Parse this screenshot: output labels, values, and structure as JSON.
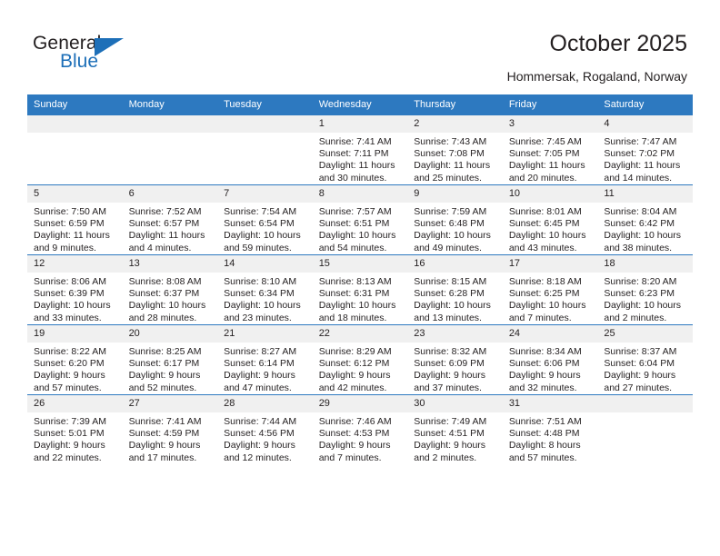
{
  "brand": {
    "name_top": "General",
    "name_bottom": "Blue",
    "accent_color": "#1d6fb8"
  },
  "header": {
    "title": "October 2025",
    "subtitle": "Hommersak, Rogaland, Norway"
  },
  "calendar": {
    "header_bg": "#2d79c0",
    "daynum_bg": "#f0f0f0",
    "weekday_headers": [
      "Sunday",
      "Monday",
      "Tuesday",
      "Wednesday",
      "Thursday",
      "Friday",
      "Saturday"
    ],
    "weeks": [
      [
        {
          "day": "",
          "sunrise": "",
          "sunset": "",
          "daylight_line1": "",
          "daylight_line2": "",
          "empty": true
        },
        {
          "day": "",
          "sunrise": "",
          "sunset": "",
          "daylight_line1": "",
          "daylight_line2": "",
          "empty": true
        },
        {
          "day": "",
          "sunrise": "",
          "sunset": "",
          "daylight_line1": "",
          "daylight_line2": "",
          "empty": true
        },
        {
          "day": "1",
          "sunrise": "Sunrise: 7:41 AM",
          "sunset": "Sunset: 7:11 PM",
          "daylight_line1": "Daylight: 11 hours",
          "daylight_line2": "and 30 minutes."
        },
        {
          "day": "2",
          "sunrise": "Sunrise: 7:43 AM",
          "sunset": "Sunset: 7:08 PM",
          "daylight_line1": "Daylight: 11 hours",
          "daylight_line2": "and 25 minutes."
        },
        {
          "day": "3",
          "sunrise": "Sunrise: 7:45 AM",
          "sunset": "Sunset: 7:05 PM",
          "daylight_line1": "Daylight: 11 hours",
          "daylight_line2": "and 20 minutes."
        },
        {
          "day": "4",
          "sunrise": "Sunrise: 7:47 AM",
          "sunset": "Sunset: 7:02 PM",
          "daylight_line1": "Daylight: 11 hours",
          "daylight_line2": "and 14 minutes."
        }
      ],
      [
        {
          "day": "5",
          "sunrise": "Sunrise: 7:50 AM",
          "sunset": "Sunset: 6:59 PM",
          "daylight_line1": "Daylight: 11 hours",
          "daylight_line2": "and 9 minutes."
        },
        {
          "day": "6",
          "sunrise": "Sunrise: 7:52 AM",
          "sunset": "Sunset: 6:57 PM",
          "daylight_line1": "Daylight: 11 hours",
          "daylight_line2": "and 4 minutes."
        },
        {
          "day": "7",
          "sunrise": "Sunrise: 7:54 AM",
          "sunset": "Sunset: 6:54 PM",
          "daylight_line1": "Daylight: 10 hours",
          "daylight_line2": "and 59 minutes."
        },
        {
          "day": "8",
          "sunrise": "Sunrise: 7:57 AM",
          "sunset": "Sunset: 6:51 PM",
          "daylight_line1": "Daylight: 10 hours",
          "daylight_line2": "and 54 minutes."
        },
        {
          "day": "9",
          "sunrise": "Sunrise: 7:59 AM",
          "sunset": "Sunset: 6:48 PM",
          "daylight_line1": "Daylight: 10 hours",
          "daylight_line2": "and 49 minutes."
        },
        {
          "day": "10",
          "sunrise": "Sunrise: 8:01 AM",
          "sunset": "Sunset: 6:45 PM",
          "daylight_line1": "Daylight: 10 hours",
          "daylight_line2": "and 43 minutes."
        },
        {
          "day": "11",
          "sunrise": "Sunrise: 8:04 AM",
          "sunset": "Sunset: 6:42 PM",
          "daylight_line1": "Daylight: 10 hours",
          "daylight_line2": "and 38 minutes."
        }
      ],
      [
        {
          "day": "12",
          "sunrise": "Sunrise: 8:06 AM",
          "sunset": "Sunset: 6:39 PM",
          "daylight_line1": "Daylight: 10 hours",
          "daylight_line2": "and 33 minutes."
        },
        {
          "day": "13",
          "sunrise": "Sunrise: 8:08 AM",
          "sunset": "Sunset: 6:37 PM",
          "daylight_line1": "Daylight: 10 hours",
          "daylight_line2": "and 28 minutes."
        },
        {
          "day": "14",
          "sunrise": "Sunrise: 8:10 AM",
          "sunset": "Sunset: 6:34 PM",
          "daylight_line1": "Daylight: 10 hours",
          "daylight_line2": "and 23 minutes."
        },
        {
          "day": "15",
          "sunrise": "Sunrise: 8:13 AM",
          "sunset": "Sunset: 6:31 PM",
          "daylight_line1": "Daylight: 10 hours",
          "daylight_line2": "and 18 minutes."
        },
        {
          "day": "16",
          "sunrise": "Sunrise: 8:15 AM",
          "sunset": "Sunset: 6:28 PM",
          "daylight_line1": "Daylight: 10 hours",
          "daylight_line2": "and 13 minutes."
        },
        {
          "day": "17",
          "sunrise": "Sunrise: 8:18 AM",
          "sunset": "Sunset: 6:25 PM",
          "daylight_line1": "Daylight: 10 hours",
          "daylight_line2": "and 7 minutes."
        },
        {
          "day": "18",
          "sunrise": "Sunrise: 8:20 AM",
          "sunset": "Sunset: 6:23 PM",
          "daylight_line1": "Daylight: 10 hours",
          "daylight_line2": "and 2 minutes."
        }
      ],
      [
        {
          "day": "19",
          "sunrise": "Sunrise: 8:22 AM",
          "sunset": "Sunset: 6:20 PM",
          "daylight_line1": "Daylight: 9 hours",
          "daylight_line2": "and 57 minutes."
        },
        {
          "day": "20",
          "sunrise": "Sunrise: 8:25 AM",
          "sunset": "Sunset: 6:17 PM",
          "daylight_line1": "Daylight: 9 hours",
          "daylight_line2": "and 52 minutes."
        },
        {
          "day": "21",
          "sunrise": "Sunrise: 8:27 AM",
          "sunset": "Sunset: 6:14 PM",
          "daylight_line1": "Daylight: 9 hours",
          "daylight_line2": "and 47 minutes."
        },
        {
          "day": "22",
          "sunrise": "Sunrise: 8:29 AM",
          "sunset": "Sunset: 6:12 PM",
          "daylight_line1": "Daylight: 9 hours",
          "daylight_line2": "and 42 minutes."
        },
        {
          "day": "23",
          "sunrise": "Sunrise: 8:32 AM",
          "sunset": "Sunset: 6:09 PM",
          "daylight_line1": "Daylight: 9 hours",
          "daylight_line2": "and 37 minutes."
        },
        {
          "day": "24",
          "sunrise": "Sunrise: 8:34 AM",
          "sunset": "Sunset: 6:06 PM",
          "daylight_line1": "Daylight: 9 hours",
          "daylight_line2": "and 32 minutes."
        },
        {
          "day": "25",
          "sunrise": "Sunrise: 8:37 AM",
          "sunset": "Sunset: 6:04 PM",
          "daylight_line1": "Daylight: 9 hours",
          "daylight_line2": "and 27 minutes."
        }
      ],
      [
        {
          "day": "26",
          "sunrise": "Sunrise: 7:39 AM",
          "sunset": "Sunset: 5:01 PM",
          "daylight_line1": "Daylight: 9 hours",
          "daylight_line2": "and 22 minutes."
        },
        {
          "day": "27",
          "sunrise": "Sunrise: 7:41 AM",
          "sunset": "Sunset: 4:59 PM",
          "daylight_line1": "Daylight: 9 hours",
          "daylight_line2": "and 17 minutes."
        },
        {
          "day": "28",
          "sunrise": "Sunrise: 7:44 AM",
          "sunset": "Sunset: 4:56 PM",
          "daylight_line1": "Daylight: 9 hours",
          "daylight_line2": "and 12 minutes."
        },
        {
          "day": "29",
          "sunrise": "Sunrise: 7:46 AM",
          "sunset": "Sunset: 4:53 PM",
          "daylight_line1": "Daylight: 9 hours",
          "daylight_line2": "and 7 minutes."
        },
        {
          "day": "30",
          "sunrise": "Sunrise: 7:49 AM",
          "sunset": "Sunset: 4:51 PM",
          "daylight_line1": "Daylight: 9 hours",
          "daylight_line2": "and 2 minutes."
        },
        {
          "day": "31",
          "sunrise": "Sunrise: 7:51 AM",
          "sunset": "Sunset: 4:48 PM",
          "daylight_line1": "Daylight: 8 hours",
          "daylight_line2": "and 57 minutes."
        },
        {
          "day": "",
          "sunrise": "",
          "sunset": "",
          "daylight_line1": "",
          "daylight_line2": "",
          "empty": true
        }
      ]
    ]
  }
}
